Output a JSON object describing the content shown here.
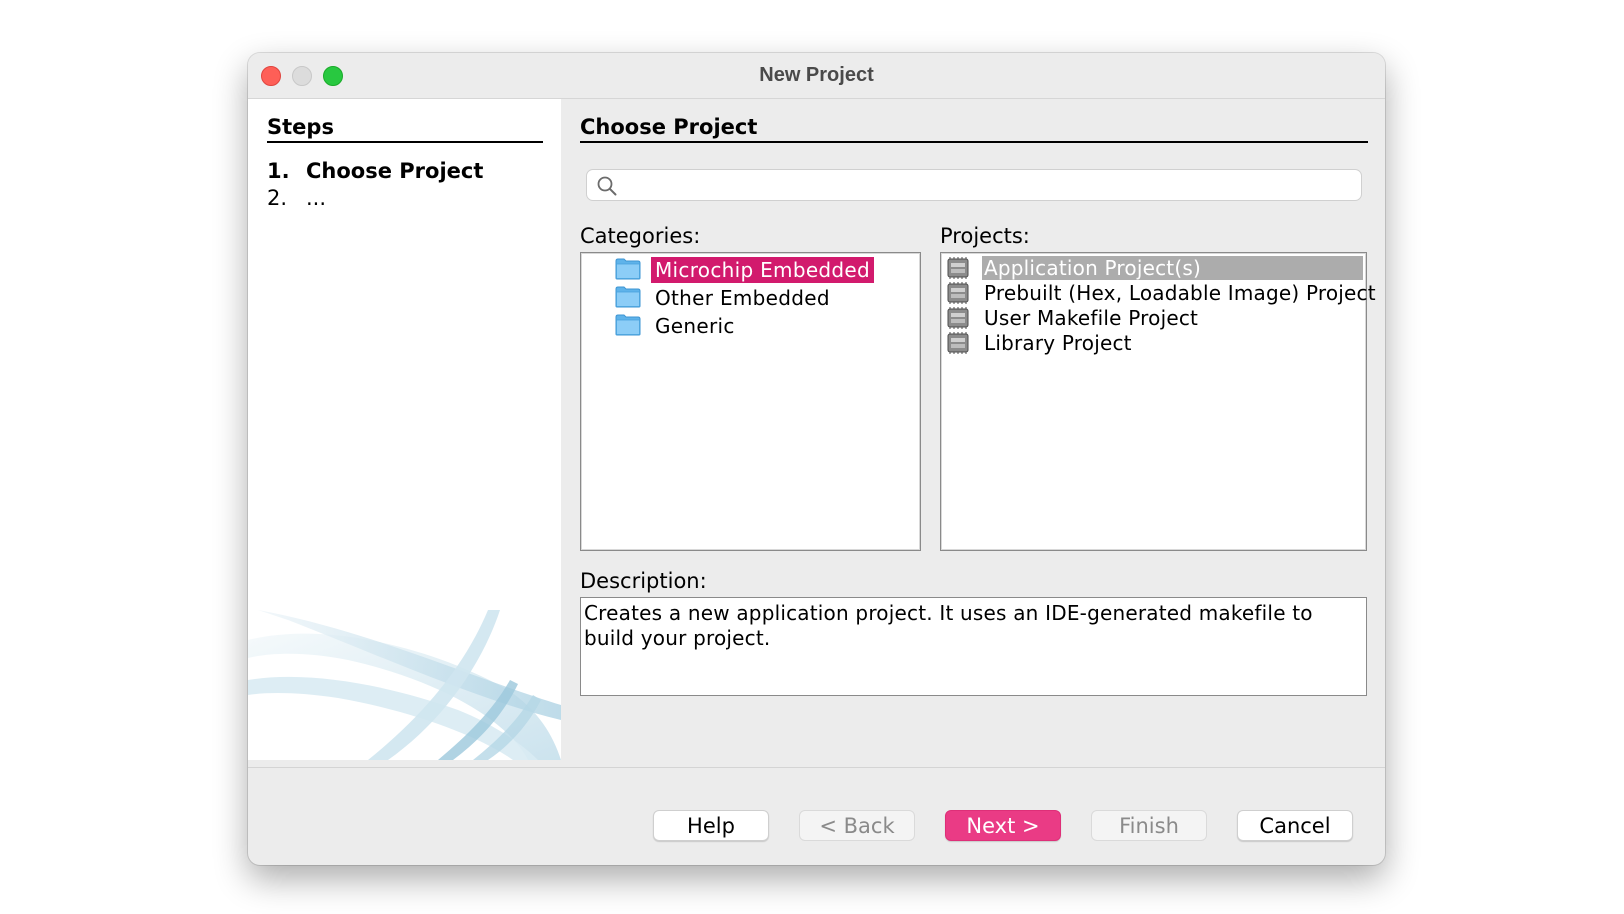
{
  "window": {
    "title": "New Project"
  },
  "steps": {
    "heading": "Steps",
    "items": [
      {
        "number": "1.",
        "label": "Choose Project"
      },
      {
        "number": "2.",
        "label": "..."
      }
    ]
  },
  "main": {
    "heading": "Choose Project",
    "search": {
      "value": "",
      "placeholder": ""
    },
    "categories": {
      "label": "Categories:",
      "items": [
        {
          "label": "Microchip Embedded",
          "icon": "folder-icon",
          "selected": true
        },
        {
          "label": "Other Embedded",
          "icon": "folder-icon",
          "selected": false
        },
        {
          "label": "Generic",
          "icon": "folder-icon",
          "selected": false
        }
      ]
    },
    "projects": {
      "label": "Projects:",
      "items": [
        {
          "label": "Application Project(s)",
          "icon": "chip-icon",
          "selected": true
        },
        {
          "label": "Prebuilt (Hex, Loadable Image) Project",
          "icon": "chip-icon",
          "selected": false
        },
        {
          "label": "User Makefile Project",
          "icon": "chip-icon",
          "selected": false
        },
        {
          "label": "Library Project",
          "icon": "chip-icon",
          "selected": false
        }
      ]
    },
    "description": {
      "label": "Description:",
      "text": "Creates a new application project. It uses an IDE-generated makefile to build your project."
    }
  },
  "buttons": {
    "help": "Help",
    "back": "< Back",
    "next": "Next >",
    "finish": "Finish",
    "cancel": "Cancel"
  },
  "colors": {
    "category_selection": "#d21a6d",
    "project_selection": "#acacac",
    "primary_button": "#ea3b85"
  }
}
